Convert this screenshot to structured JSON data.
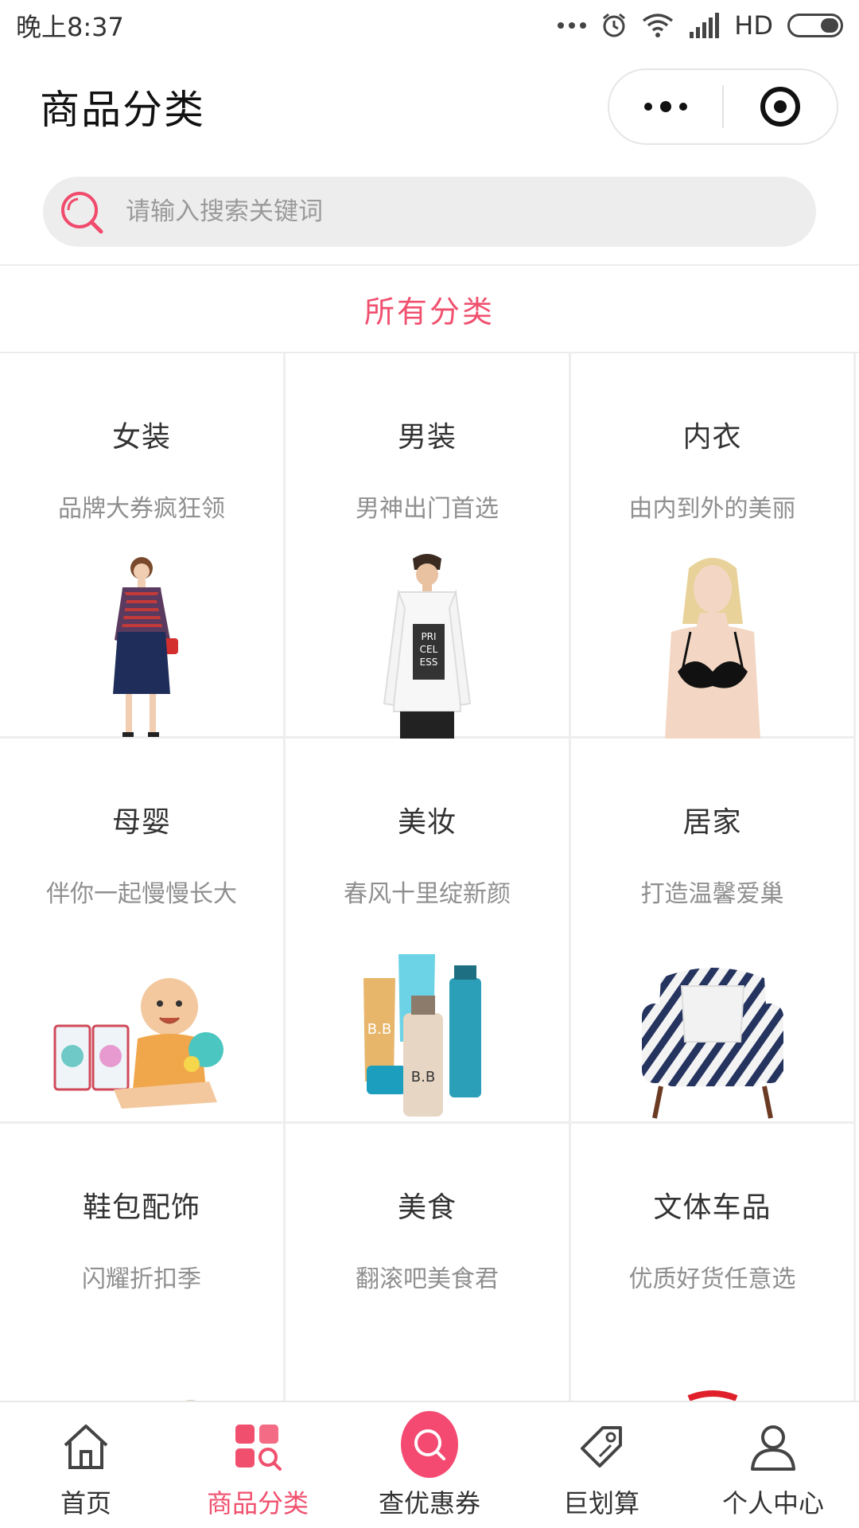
{
  "status_bar": {
    "time": "晚上8:37",
    "network": "HD"
  },
  "header": {
    "title": "商品分类"
  },
  "search": {
    "placeholder": "请输入搜索关键词"
  },
  "section": {
    "title": "所有分类"
  },
  "categories": [
    {
      "name": "女装",
      "subtitle": "品牌大券疯狂领",
      "icon": "dress-icon"
    },
    {
      "name": "男装",
      "subtitle": "男神出门首选",
      "icon": "sweater-icon"
    },
    {
      "name": "内衣",
      "subtitle": "由内到外的美丽",
      "icon": "lingerie-icon"
    },
    {
      "name": "母婴",
      "subtitle": "伴你一起慢慢长大",
      "icon": "baby-toy-icon"
    },
    {
      "name": "美妆",
      "subtitle": "春风十里绽新颜",
      "icon": "cosmetics-icon"
    },
    {
      "name": "居家",
      "subtitle": "打造温馨爱巢",
      "icon": "armchair-icon"
    },
    {
      "name": "鞋包配饰",
      "subtitle": "闪耀折扣季",
      "icon": "sandal-icon"
    },
    {
      "name": "美食",
      "subtitle": "翻滚吧美食君",
      "icon": "snack-box-icon"
    },
    {
      "name": "文体车品",
      "subtitle": "优质好货任意选",
      "icon": "steering-wheel-icon"
    }
  ],
  "tabbar": {
    "active": 1,
    "accent_color": "#f0506e",
    "items": [
      {
        "label": "首页",
        "icon": "home-icon"
      },
      {
        "label": "商品分类",
        "icon": "category-grid-icon"
      },
      {
        "label": "查优惠券",
        "icon": "coupon-search-icon"
      },
      {
        "label": "巨划算",
        "icon": "price-tag-icon"
      },
      {
        "label": "个人中心",
        "icon": "user-icon"
      }
    ]
  }
}
